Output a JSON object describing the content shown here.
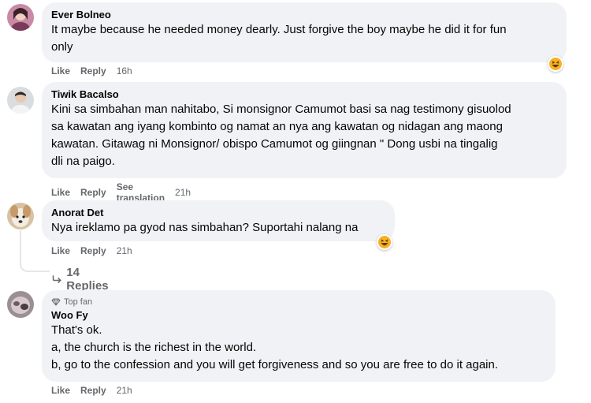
{
  "comments": [
    {
      "author": "Ever Bolneo",
      "text": "It maybe because he needed money dearly. Just forgive the boy maybe he did it for fun\nonly",
      "like": "Like",
      "reply": "Reply",
      "time": "16h"
    },
    {
      "author": "Tiwik Bacalso",
      "text": "Kini sa simbahan man nahitabo, Si monsignor Camumot basi sa nag testimony gisuolod\nsa kawatan ang iyang kombinto og namat an nya ang kawatan og nidagan ang maong\nkawatan. Gitawag ni Monsignor/ obispo Camumot og giingnan \" Dong usbi na tingalig\ndli na paigo.",
      "like": "Like",
      "reply": "Reply",
      "translate": "See translation",
      "time": "21h"
    },
    {
      "author": "Anorat Det",
      "text": "Nya ireklamo pa gyod nas simbahan? Suportahi nalang na",
      "like": "Like",
      "reply": "Reply",
      "time": "21h",
      "replies_label": "14 Replies"
    },
    {
      "badge": "Top fan",
      "author": "Woo Fy",
      "text": "That's ok.\na, the church is the richest in the world.\nb, go to the confession and you will get forgiveness and so you are free to do it again.",
      "like": "Like",
      "reply": "Reply",
      "time": "21h"
    }
  ],
  "colors": {
    "bubble": "#f0f2f5",
    "meta": "#65676b",
    "text": "#050505",
    "reaction_face": "#f7b125"
  },
  "icons": {
    "reaction": "laughing-emoji-icon",
    "replies_arrow": "reply-arrow-icon",
    "top_fan": "top-fan-badge-icon"
  }
}
